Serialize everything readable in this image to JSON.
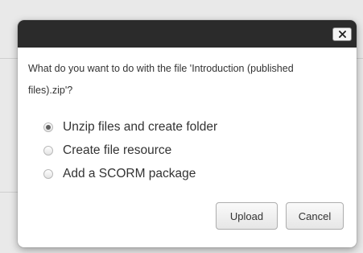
{
  "dialog": {
    "message": "What do you want to do with the file 'Introduction (published files).zip'?",
    "close_icon": "close-icon"
  },
  "options": [
    {
      "label": "Unzip files and create folder",
      "checked": true
    },
    {
      "label": "Create file resource",
      "checked": false
    },
    {
      "label": "Add a SCORM package",
      "checked": false
    }
  ],
  "buttons": {
    "upload_label": "Upload",
    "cancel_label": "Cancel"
  },
  "colors": {
    "titlebar": "#2b2b2b",
    "text": "#333333"
  }
}
